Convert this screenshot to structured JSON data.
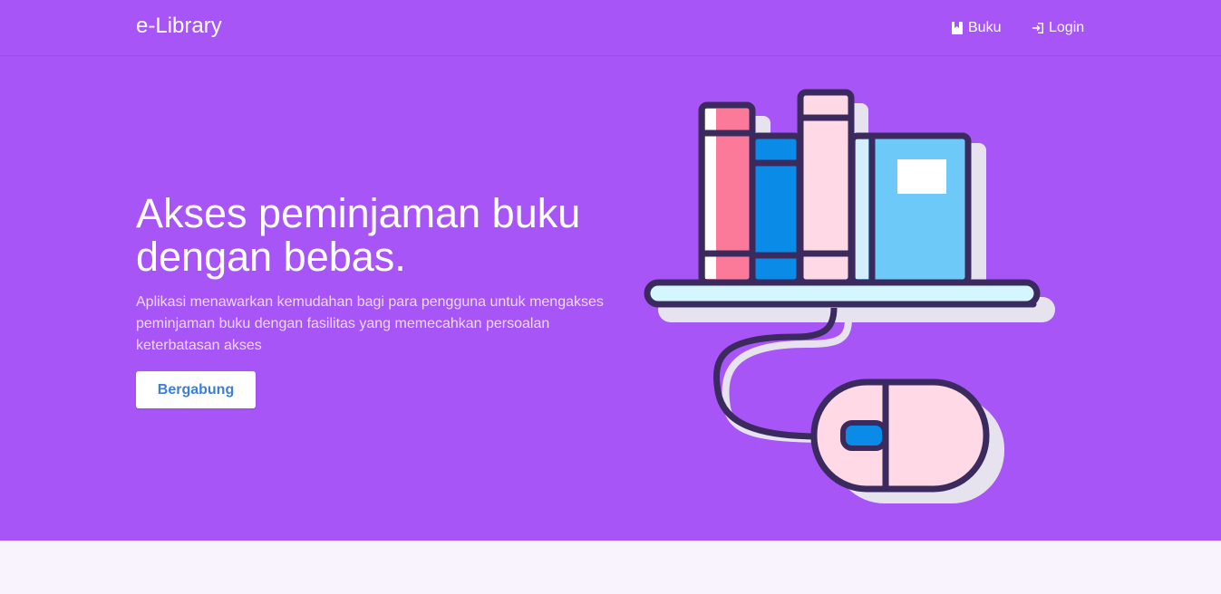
{
  "theme": {
    "primary": "#a855f7",
    "primary_dark": "#3b2a5d",
    "lower_bg": "#f9f3fe",
    "button_text": "#3b7ddd",
    "white": "#ffffff"
  },
  "navbar": {
    "brand": "e-Library",
    "links": [
      {
        "label": "Buku",
        "icon": "book-icon"
      },
      {
        "label": "Login",
        "icon": "login-icon"
      }
    ]
  },
  "hero": {
    "title": "Akses peminjaman buku dengan bebas.",
    "subtitle": "Aplikasi menawarkan kemudahan bagi para pengguna untuk mengakses peminjaman buku dengan fasilitas yang memecahkan persoalan keterbatasan akses",
    "cta_label": "Bergabung",
    "illustration": "books-on-shelf-with-mouse-illustration"
  }
}
